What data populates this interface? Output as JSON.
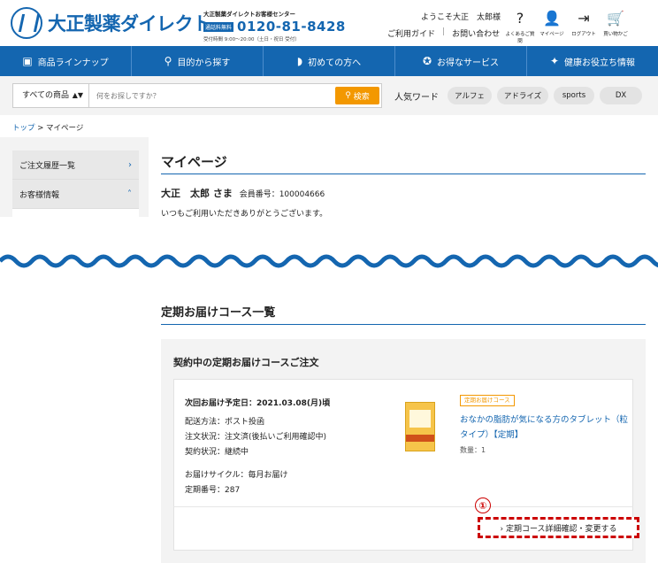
{
  "header": {
    "logo_text": "大正製薬ダイレクト",
    "tel_label": "大正製薬ダイレクトお客様センター",
    "tel_free": "通話料無料",
    "tel_number": "0120-81-8428",
    "tel_hours": "受付時間 9:00〜20:00（土日・祝日 受付）",
    "welcome": "ようこそ大正　太郎様",
    "links": {
      "guide": "ご利用ガイド",
      "sep": "|",
      "contact": "お問い合わせ"
    },
    "icons": [
      {
        "name": "help-icon",
        "glyph": "?",
        "label": "よくあるご質問"
      },
      {
        "name": "user-icon",
        "glyph": "👤",
        "label": "マイページ"
      },
      {
        "name": "logout-icon",
        "glyph": "⇥",
        "label": "ログアウト"
      },
      {
        "name": "cart-icon",
        "glyph": "🛒",
        "label": "買い物かご"
      }
    ]
  },
  "nav": {
    "items": [
      {
        "icon": "▣",
        "label": "商品ラインナップ"
      },
      {
        "icon": "⚲",
        "label": "目的から探す"
      },
      {
        "icon": "◗",
        "label": "初めての方へ"
      },
      {
        "icon": "✪",
        "label": "お得なサービス"
      },
      {
        "icon": "✦",
        "label": "健康お役立ち情報"
      }
    ]
  },
  "search": {
    "category": "すべての商品",
    "category_arrows": "▲▼",
    "placeholder": "何をお探しですか？",
    "button": "検索",
    "popular_label": "人気ワード",
    "keywords": [
      "アルフェ",
      "アドライズ",
      "sports",
      "DX"
    ]
  },
  "breadcrumb": {
    "home": "トップ",
    "sep": ">",
    "current": "マイページ"
  },
  "sidebar": {
    "items": [
      {
        "label": "ご注文履歴一覧",
        "chev": "›"
      },
      {
        "label": "お客様情報",
        "chev": "˄"
      }
    ]
  },
  "mypage": {
    "title": "マイページ",
    "member_name": "大正　太郎 さま",
    "member_no": "会員番号：100004666",
    "thanks": "いつもご利用いただきありがとうございます。"
  },
  "course": {
    "section_title": "定期お届けコース一覧",
    "panel_title": "契約中の定期お届けコースご注文",
    "next_delivery": "次回お届け予定日：2021.03.08(月)頃",
    "delivery_method": "配送方法：ポスト投函",
    "order_status": "注文状況：注文済(後払いご利用確認中)",
    "contract_status": "契約状況：継続中",
    "cycle": "お届けサイクル：毎月お届け",
    "course_no": "定期番号：287",
    "badge": "定期お届けコース",
    "product_name": "おなかの脂肪が気になる方のタブレット（粒タイプ）【定期】",
    "quantity": "数量：1",
    "marker": "①",
    "detail_link": "› 定期コース詳細確認・変更する"
  },
  "colors": {
    "brand": "#1466b0",
    "accent": "#f39800",
    "highlight": "#cc0000"
  }
}
